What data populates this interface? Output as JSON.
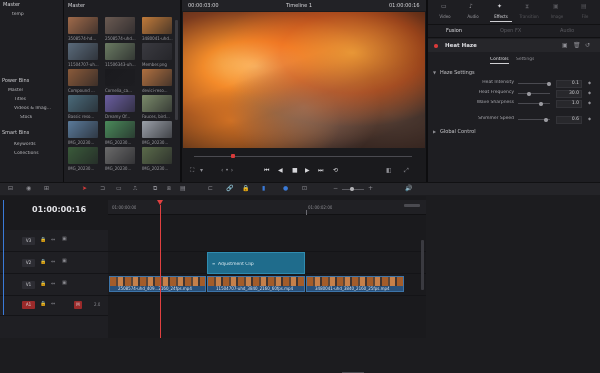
{
  "media_pool": {
    "master_label": "Master",
    "bin_items": [
      "Master",
      "temp"
    ],
    "power_bins_label": "Power Bins",
    "power_bins_items": [
      "Master",
      "Titles",
      "Videos & Imag...",
      "Stock"
    ],
    "smart_bins_label": "Smart Bins",
    "smart_bins_items": [
      "Keywords",
      "Collections"
    ],
    "clips": [
      {
        "name": "3508574-hd...",
        "color": "#a06a4a"
      },
      {
        "name": "2508574-uhd...",
        "color": "#6a5a52"
      },
      {
        "name": "3480041-uhd...",
        "color": "#c07a3a"
      },
      {
        "name": "11504707-uh...",
        "color": "#5a6a7a"
      },
      {
        "name": "11506343-uh...",
        "color": "#6a7a62"
      },
      {
        "name": "Member.png",
        "color": "#3a3a40"
      },
      {
        "name": "Compound ...",
        "color": "#8a5a3a"
      },
      {
        "name": "Cornelia_ca...",
        "color": "#1a1a1e"
      },
      {
        "name": "devici-reso...",
        "color": "#b07040"
      },
      {
        "name": "Bassic reso...",
        "color": "#4a6a7a"
      },
      {
        "name": "Dreamy Of...",
        "color": "#6a5ea0"
      },
      {
        "name": "Fauces, bird...",
        "color": "#7a8a6a"
      },
      {
        "name": "IMG_20230...",
        "color": "#5a7a9a"
      },
      {
        "name": "IMG_20230...",
        "color": "#4a8a5a"
      },
      {
        "name": "IMG_20230...",
        "color": "#9aa0a8"
      },
      {
        "name": "IMG_20230...",
        "color": "#3a5a3a"
      },
      {
        "name": "IMG_20230...",
        "color": "#6a6a6a"
      },
      {
        "name": "IMG_20230...",
        "color": "#5a6a4a"
      }
    ]
  },
  "viewer": {
    "timecode_left": "00:00:03:00",
    "timeline_name": "Timeline 1",
    "timecode_right": "01:00:00:16"
  },
  "inspector": {
    "top_tabs": [
      {
        "label": "Video",
        "icon": "video-icon"
      },
      {
        "label": "Audio",
        "icon": "audio-icon"
      },
      {
        "label": "Effects",
        "icon": "effects-icon"
      },
      {
        "label": "Transition",
        "icon": "transition-icon"
      },
      {
        "label": "Image",
        "icon": "image-icon"
      },
      {
        "label": "File",
        "icon": "file-icon"
      }
    ],
    "sub_tabs": [
      "Fusion",
      "Open FX",
      "Audio"
    ],
    "effect_name": "Heat Haze",
    "effect_tabs": [
      "Controls",
      "Settings"
    ],
    "section_haze": "Haze Settings",
    "params": [
      {
        "label": "Heat Intensity",
        "value": "0.1",
        "level": 0.98
      },
      {
        "label": "Heat Frequency",
        "value": "30.0",
        "level": 0.35
      },
      {
        "label": "Wave Sharpness",
        "value": "1.0",
        "level": 0.72
      },
      {
        "label": "Shimmer Speed",
        "value": "0.6",
        "level": 0.86
      }
    ],
    "section_global": "Global Control"
  },
  "timeline": {
    "timecode": "01:00:00:16",
    "ruler": [
      "01:00:00:00",
      "01:00:02:00"
    ],
    "tracks": [
      {
        "id": "V3",
        "active": false
      },
      {
        "id": "V2",
        "active": false
      },
      {
        "id": "V1",
        "active": false
      },
      {
        "id": "A1",
        "active": true
      }
    ],
    "audio_level": "2.0",
    "adjustment_clip": "Adjustment Clip",
    "clips": [
      {
        "name": "2508574-uhd_409...2160_24fps.mp4"
      },
      {
        "name": "11504707-uhd_3840_2160_60fps.mp4"
      },
      {
        "name": "3480041-uhd_3840_2160_25fps.mp4"
      }
    ]
  }
}
